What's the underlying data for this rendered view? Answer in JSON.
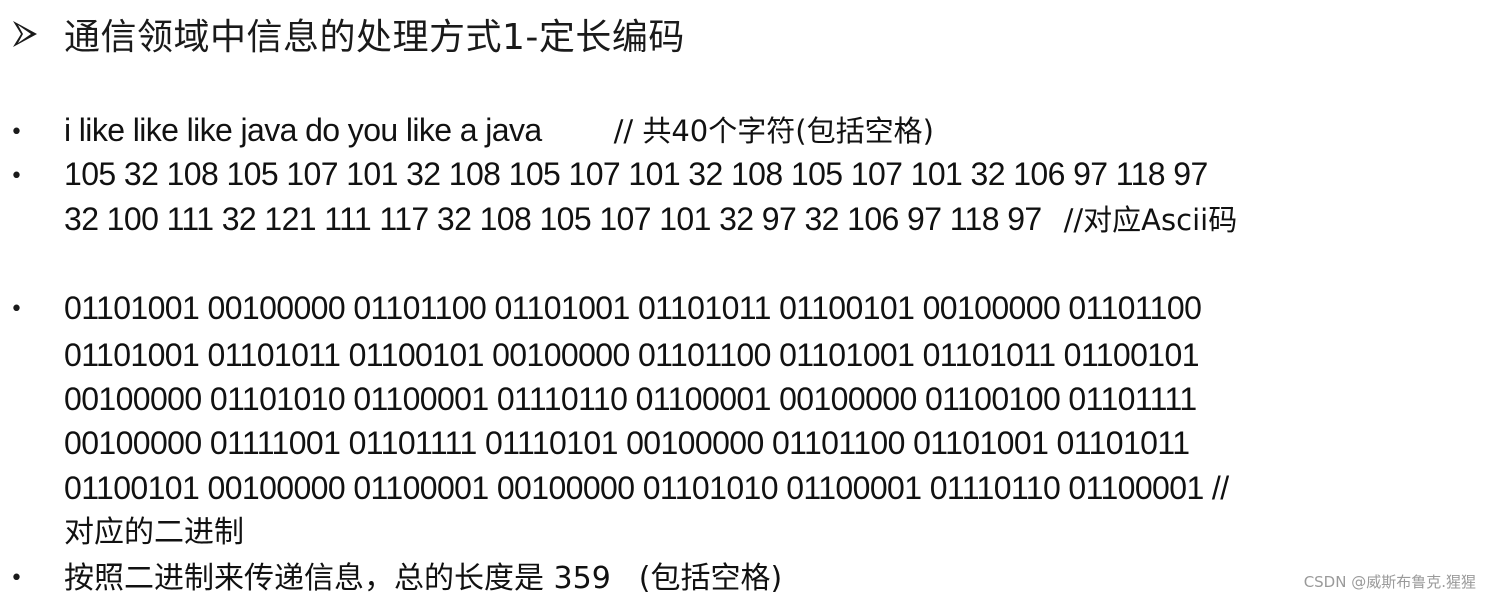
{
  "title": "通信领域中信息的处理方式1-定长编码",
  "bullet_symbol": "•",
  "items": [
    {
      "text": "i like like like java do you like a java",
      "note": "// 共40个字符(包括空格)"
    },
    {
      "lines": [
        "105 32 108 105 107 101 32 108 105 107 101 32 108 105 107 101 32 106 97 118 97",
        "32 100 111 32 121 111 117 32 108 105 107 101 32 97 32 106 97 118 97"
      ],
      "note": "//对应Ascii码"
    },
    {
      "lines": [
        "01101001 00100000 01101100 01101001 01101011 01100101 00100000 01101100",
        "01101001 01101011 01100101 00100000 01101100 01101001 01101011 01100101",
        "00100000 01101010 01100001 01110110 01100001 00100000 01100100 01101111",
        "00100000 01111001 01101111 01110101 00100000 01101100 01101001 01101011",
        "01100101 00100000 01100001 00100000 01101010 01100001 01110110 01100001 //"
      ],
      "continuation": "对应的二进制"
    },
    {
      "text": "按照二进制来传递信息，总的长度是 359",
      "note": "(包括空格)"
    }
  ],
  "watermark": "CSDN @威斯布鲁克.猩猩"
}
